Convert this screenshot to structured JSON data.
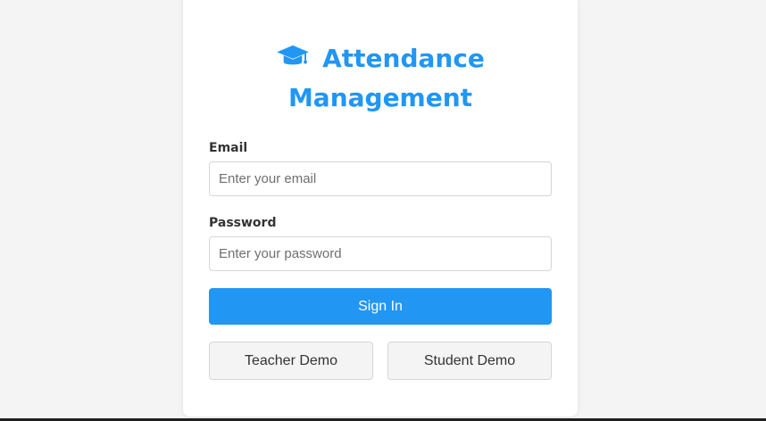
{
  "app": {
    "title_line1": "Attendance",
    "title_line2": "Management",
    "icon": "graduation-cap-icon",
    "accent_color": "#2196f3"
  },
  "form": {
    "email_label": "Email",
    "email_placeholder": "Enter your email",
    "email_value": "",
    "password_label": "Password",
    "password_placeholder": "Enter your password",
    "password_value": "",
    "signin_label": "Sign In"
  },
  "demo": {
    "teacher_label": "Teacher Demo",
    "student_label": "Student Demo"
  }
}
